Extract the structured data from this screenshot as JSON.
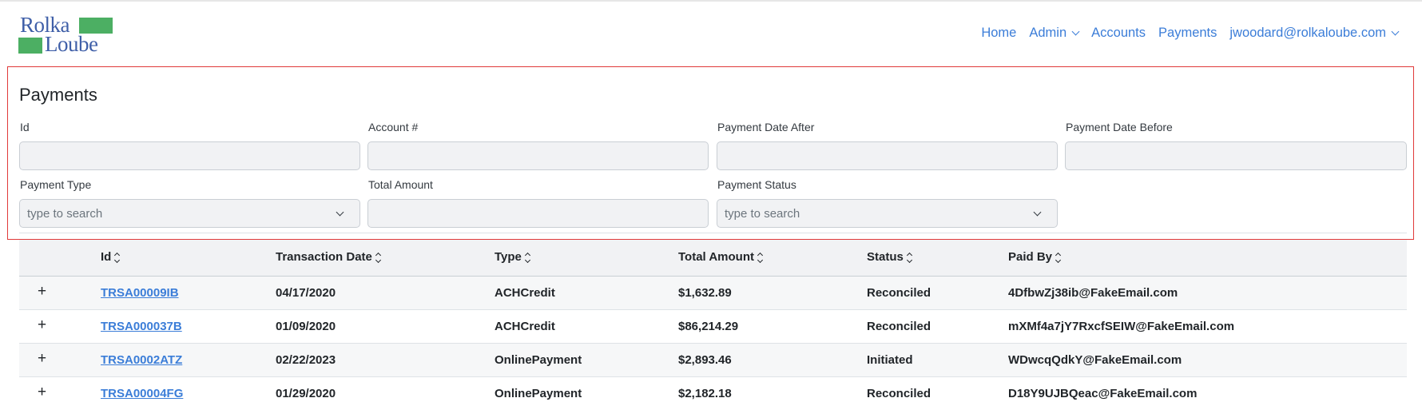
{
  "brand": {
    "line1": "Rolka",
    "line2": "Loube"
  },
  "nav": {
    "home": "Home",
    "admin": "Admin",
    "accounts": "Accounts",
    "payments": "Payments",
    "user": "jwoodard@rolkaloube.com"
  },
  "filters": {
    "title": "Payments",
    "id_label": "Id",
    "account_label": "Account #",
    "date_after_label": "Payment Date After",
    "date_before_label": "Payment Date Before",
    "payment_type_label": "Payment Type",
    "payment_type_placeholder": "type to search",
    "total_amount_label": "Total Amount",
    "payment_status_label": "Payment Status",
    "payment_status_placeholder": "type to search"
  },
  "table": {
    "headers": {
      "id": "Id",
      "date": "Transaction Date",
      "type": "Type",
      "amount": "Total Amount",
      "status": "Status",
      "paid_by": "Paid By"
    },
    "expand_symbol": "+",
    "rows": [
      {
        "id": "TRSA00009IB",
        "date": "04/17/2020",
        "type": "ACHCredit",
        "amount": "$1,632.89",
        "status": "Reconciled",
        "paid_by": "4DfbwZj38ib@FakeEmail.com"
      },
      {
        "id": "TRSA000037B",
        "date": "01/09/2020",
        "type": "ACHCredit",
        "amount": "$86,214.29",
        "status": "Reconciled",
        "paid_by": "mXMf4a7jY7RxcfSEIW@FakeEmail.com"
      },
      {
        "id": "TRSA0002ATZ",
        "date": "02/22/2023",
        "type": "OnlinePayment",
        "amount": "$2,893.46",
        "status": "Initiated",
        "paid_by": "WDwcqQdkY@FakeEmail.com"
      },
      {
        "id": "TRSA00004FG",
        "date": "01/29/2020",
        "type": "OnlinePayment",
        "amount": "$2,182.18",
        "status": "Reconciled",
        "paid_by": "D18Y9UJBQeac@FakeEmail.com"
      }
    ]
  },
  "colors": {
    "link": "#3b7dd8",
    "logo_text": "#3f5fa8",
    "logo_green": "#4caf63",
    "highlight_border": "#e03a3a"
  }
}
